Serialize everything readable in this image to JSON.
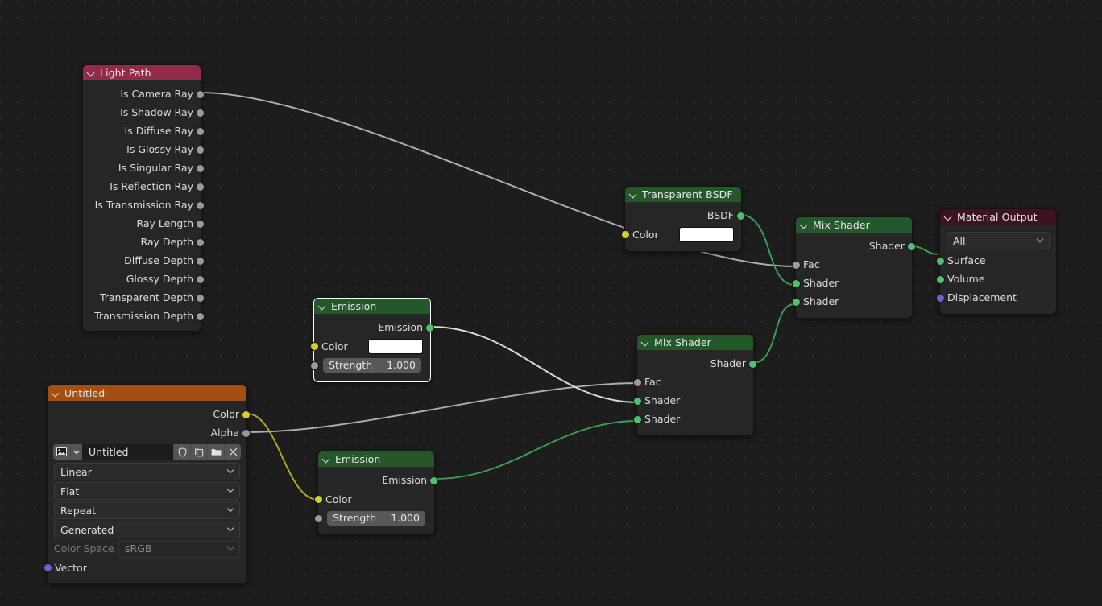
{
  "editor": {
    "name": "Shader Editor",
    "background": "#1d1d1d"
  },
  "colors": {
    "header_green": "#24582a",
    "header_red": "#902b4a",
    "header_output": "#3b1420",
    "header_orange": "#a34e12",
    "socket_shader": "#4ec16e",
    "socket_color": "#d6cf28",
    "socket_value": "#9a9a9a",
    "socket_vector": "#6b62d8",
    "wire_value": "#b0b0b0",
    "wire_shader": "#3f9e50",
    "wire_color": "#b3ad1e",
    "wire_selected": "#c8e6c9"
  },
  "nodes": {
    "light_path": {
      "title": "Light Path",
      "outputs": [
        "Is Camera Ray",
        "Is Shadow Ray",
        "Is Diffuse Ray",
        "Is Glossy Ray",
        "Is Singular Ray",
        "Is Reflection Ray",
        "Is Transmission Ray",
        "Ray Length",
        "Ray Depth",
        "Diffuse Depth",
        "Glossy Depth",
        "Transparent Depth",
        "Transmission Depth"
      ]
    },
    "image_texture": {
      "title": "Untitled",
      "outputs": [
        "Color",
        "Alpha"
      ],
      "datablock_name": "Untitled",
      "icons": [
        "image-icon",
        "chevron-down-icon",
        "shield-icon",
        "duplicate-icon",
        "folder-icon",
        "close-icon"
      ],
      "interpolation": "Linear",
      "projection": "Flat",
      "extension": "Repeat",
      "source": "Generated",
      "color_space_label": "Color Space",
      "color_space_value": "sRGB",
      "inputs": [
        "Vector"
      ]
    },
    "emission_top": {
      "title": "Emission",
      "outputs": [
        "Emission"
      ],
      "color_label": "Color",
      "color_value": "#ffffff",
      "strength_label": "Strength",
      "strength_value": "1.000",
      "selected": true
    },
    "emission_bottom": {
      "title": "Emission",
      "outputs": [
        "Emission"
      ],
      "color_label": "Color",
      "strength_label": "Strength",
      "strength_value": "1.000",
      "selected": false
    },
    "transparent_bsdf": {
      "title": "Transparent BSDF",
      "outputs": [
        "BSDF"
      ],
      "color_label": "Color",
      "color_value": "#ffffff"
    },
    "mix_shader_top": {
      "title": "Mix Shader",
      "outputs": [
        "Shader"
      ],
      "inputs": [
        "Fac",
        "Shader",
        "Shader"
      ]
    },
    "mix_shader_bottom": {
      "title": "Mix Shader",
      "outputs": [
        "Shader"
      ],
      "inputs": [
        "Fac",
        "Shader",
        "Shader"
      ]
    },
    "material_output": {
      "title": "Material Output",
      "target": "All",
      "inputs": [
        "Surface",
        "Volume",
        "Displacement"
      ]
    }
  }
}
